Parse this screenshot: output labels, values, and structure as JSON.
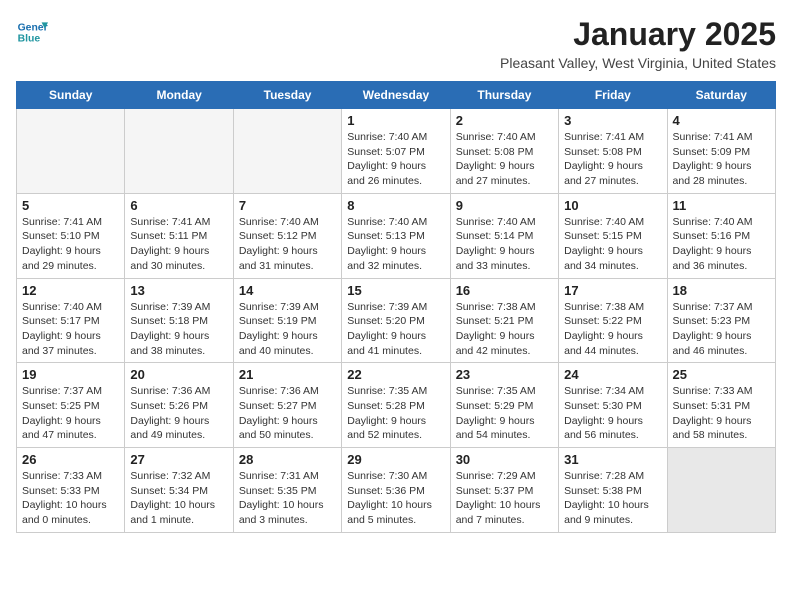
{
  "logo": {
    "line1": "General",
    "line2": "Blue"
  },
  "title": "January 2025",
  "subtitle": "Pleasant Valley, West Virginia, United States",
  "weekdays": [
    "Sunday",
    "Monday",
    "Tuesday",
    "Wednesday",
    "Thursday",
    "Friday",
    "Saturday"
  ],
  "weeks": [
    [
      {
        "day": "",
        "info": "",
        "empty": true
      },
      {
        "day": "",
        "info": "",
        "empty": true
      },
      {
        "day": "",
        "info": "",
        "empty": true
      },
      {
        "day": "1",
        "info": "Sunrise: 7:40 AM\nSunset: 5:07 PM\nDaylight: 9 hours and 26 minutes."
      },
      {
        "day": "2",
        "info": "Sunrise: 7:40 AM\nSunset: 5:08 PM\nDaylight: 9 hours and 27 minutes."
      },
      {
        "day": "3",
        "info": "Sunrise: 7:41 AM\nSunset: 5:08 PM\nDaylight: 9 hours and 27 minutes."
      },
      {
        "day": "4",
        "info": "Sunrise: 7:41 AM\nSunset: 5:09 PM\nDaylight: 9 hours and 28 minutes."
      }
    ],
    [
      {
        "day": "5",
        "info": "Sunrise: 7:41 AM\nSunset: 5:10 PM\nDaylight: 9 hours and 29 minutes."
      },
      {
        "day": "6",
        "info": "Sunrise: 7:41 AM\nSunset: 5:11 PM\nDaylight: 9 hours and 30 minutes."
      },
      {
        "day": "7",
        "info": "Sunrise: 7:40 AM\nSunset: 5:12 PM\nDaylight: 9 hours and 31 minutes."
      },
      {
        "day": "8",
        "info": "Sunrise: 7:40 AM\nSunset: 5:13 PM\nDaylight: 9 hours and 32 minutes."
      },
      {
        "day": "9",
        "info": "Sunrise: 7:40 AM\nSunset: 5:14 PM\nDaylight: 9 hours and 33 minutes."
      },
      {
        "day": "10",
        "info": "Sunrise: 7:40 AM\nSunset: 5:15 PM\nDaylight: 9 hours and 34 minutes."
      },
      {
        "day": "11",
        "info": "Sunrise: 7:40 AM\nSunset: 5:16 PM\nDaylight: 9 hours and 36 minutes."
      }
    ],
    [
      {
        "day": "12",
        "info": "Sunrise: 7:40 AM\nSunset: 5:17 PM\nDaylight: 9 hours and 37 minutes."
      },
      {
        "day": "13",
        "info": "Sunrise: 7:39 AM\nSunset: 5:18 PM\nDaylight: 9 hours and 38 minutes."
      },
      {
        "day": "14",
        "info": "Sunrise: 7:39 AM\nSunset: 5:19 PM\nDaylight: 9 hours and 40 minutes."
      },
      {
        "day": "15",
        "info": "Sunrise: 7:39 AM\nSunset: 5:20 PM\nDaylight: 9 hours and 41 minutes."
      },
      {
        "day": "16",
        "info": "Sunrise: 7:38 AM\nSunset: 5:21 PM\nDaylight: 9 hours and 42 minutes."
      },
      {
        "day": "17",
        "info": "Sunrise: 7:38 AM\nSunset: 5:22 PM\nDaylight: 9 hours and 44 minutes."
      },
      {
        "day": "18",
        "info": "Sunrise: 7:37 AM\nSunset: 5:23 PM\nDaylight: 9 hours and 46 minutes."
      }
    ],
    [
      {
        "day": "19",
        "info": "Sunrise: 7:37 AM\nSunset: 5:25 PM\nDaylight: 9 hours and 47 minutes."
      },
      {
        "day": "20",
        "info": "Sunrise: 7:36 AM\nSunset: 5:26 PM\nDaylight: 9 hours and 49 minutes."
      },
      {
        "day": "21",
        "info": "Sunrise: 7:36 AM\nSunset: 5:27 PM\nDaylight: 9 hours and 50 minutes."
      },
      {
        "day": "22",
        "info": "Sunrise: 7:35 AM\nSunset: 5:28 PM\nDaylight: 9 hours and 52 minutes."
      },
      {
        "day": "23",
        "info": "Sunrise: 7:35 AM\nSunset: 5:29 PM\nDaylight: 9 hours and 54 minutes."
      },
      {
        "day": "24",
        "info": "Sunrise: 7:34 AM\nSunset: 5:30 PM\nDaylight: 9 hours and 56 minutes."
      },
      {
        "day": "25",
        "info": "Sunrise: 7:33 AM\nSunset: 5:31 PM\nDaylight: 9 hours and 58 minutes."
      }
    ],
    [
      {
        "day": "26",
        "info": "Sunrise: 7:33 AM\nSunset: 5:33 PM\nDaylight: 10 hours and 0 minutes."
      },
      {
        "day": "27",
        "info": "Sunrise: 7:32 AM\nSunset: 5:34 PM\nDaylight: 10 hours and 1 minute."
      },
      {
        "day": "28",
        "info": "Sunrise: 7:31 AM\nSunset: 5:35 PM\nDaylight: 10 hours and 3 minutes."
      },
      {
        "day": "29",
        "info": "Sunrise: 7:30 AM\nSunset: 5:36 PM\nDaylight: 10 hours and 5 minutes."
      },
      {
        "day": "30",
        "info": "Sunrise: 7:29 AM\nSunset: 5:37 PM\nDaylight: 10 hours and 7 minutes."
      },
      {
        "day": "31",
        "info": "Sunrise: 7:28 AM\nSunset: 5:38 PM\nDaylight: 10 hours and 9 minutes."
      },
      {
        "day": "",
        "info": "",
        "empty": true
      }
    ]
  ]
}
